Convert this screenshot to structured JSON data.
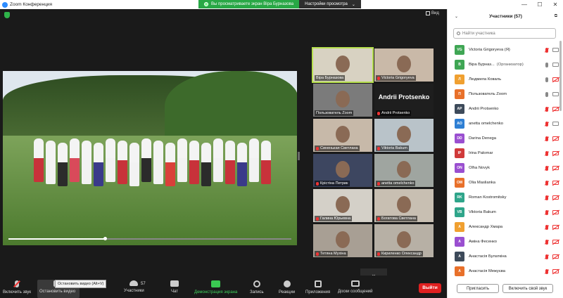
{
  "window": {
    "title": "Zoom Конференция",
    "share_banner": "Вы просматриваете экран Віра Бурназова",
    "view_options": "Настройки просмотра",
    "view_label": "Вид"
  },
  "tiles": [
    {
      "name": "Віра Бурназова",
      "mic": "on",
      "active": true
    },
    {
      "name": "Victoria Grigoryeva",
      "mic": "off"
    },
    {
      "name": "Пользователь Zoom",
      "mic": "on"
    },
    {
      "name": "Andrii Protsenko",
      "mic": "off",
      "big_name": "Andrii Protsenko"
    },
    {
      "name": "Синенькая Светлана",
      "mic": "off"
    },
    {
      "name": "Viktoria Bakum",
      "mic": "off"
    },
    {
      "name": "Крістіна Петрик",
      "mic": "off"
    },
    {
      "name": "anetta omelchenko",
      "mic": "off"
    },
    {
      "name": "Галина Юрьевна",
      "mic": "off"
    },
    {
      "name": "Богатова Светлана",
      "mic": "off"
    },
    {
      "name": "Тетяна Мухіна",
      "mic": "off"
    },
    {
      "name": "Кириленко Олександр",
      "mic": "off"
    }
  ],
  "shared_video": {
    "progress": 0.34
  },
  "toolbar": {
    "unmute": "Включить звук",
    "stop_video": "Остановить видео",
    "tooltip": "Остановить видео (Alt+V)",
    "participants": "Участники",
    "participants_count": "57",
    "chat": "Чат",
    "share": "Демонстрация экрана",
    "record": "Запись",
    "reactions": "Реакции",
    "apps": "Приложения",
    "whiteboards": "Доски сообщений",
    "leave": "Выйти"
  },
  "panel": {
    "title": "Участники (57)",
    "search_placeholder": "Найти участника",
    "invite": "Пригласить",
    "unmute_me": "Включить свой звук",
    "participants": [
      {
        "initials": "VG",
        "name": "Victoria Grigoryeva (Я)",
        "color": "#3fa654",
        "mic": "off",
        "video": "on",
        "tag": ""
      },
      {
        "initials": "В",
        "name": "Віра Бурназ...",
        "color": "#3fa654",
        "mic": "on",
        "video": "on",
        "tag": "(Организатор)"
      },
      {
        "initials": "Л",
        "name": "Людмила Коваль",
        "color": "#f0a030",
        "mic": "on",
        "video": "off",
        "tag": ""
      },
      {
        "initials": "П",
        "name": "Пользователь Zoom",
        "color": "#e8702a",
        "mic": "on",
        "video": "on",
        "tag": ""
      },
      {
        "initials": "AP",
        "name": "Andrii Protsenko",
        "color": "#3d4a5a",
        "mic": "off",
        "video": "off",
        "tag": ""
      },
      {
        "initials": "AO",
        "name": "anetta omelchenko",
        "color": "#2e7fd4",
        "mic": "off",
        "video": "on",
        "tag": ""
      },
      {
        "initials": "DD",
        "name": "Darina Denega",
        "color": "#9a4fd0",
        "mic": "off",
        "video": "off",
        "tag": ""
      },
      {
        "initials": "IP",
        "name": "Irina Palomar",
        "color": "#d03a3a",
        "mic": "off",
        "video": "off",
        "tag": ""
      },
      {
        "initials": "ON",
        "name": "Olha Novyk",
        "color": "#9a4fd0",
        "mic": "off",
        "video": "off",
        "tag": ""
      },
      {
        "initials": "OM",
        "name": "Olia Maslianka",
        "color": "#e8702a",
        "mic": "off",
        "video": "off",
        "tag": ""
      },
      {
        "initials": "RK",
        "name": "Roman Kostromitsky",
        "color": "#2fa58a",
        "mic": "off",
        "video": "off",
        "tag": ""
      },
      {
        "initials": "VB",
        "name": "Viktoria Bakum",
        "color": "#2fa58a",
        "mic": "off",
        "video": "off",
        "tag": ""
      },
      {
        "initials": "А",
        "name": "Александр Хмара",
        "color": "#f0a030",
        "mic": "off",
        "video": "off",
        "tag": ""
      },
      {
        "initials": "А",
        "name": "Аміна Фесенко",
        "color": "#9a4fd0",
        "mic": "off",
        "video": "off",
        "tag": ""
      },
      {
        "initials": "А",
        "name": "Анастасія Булаткіна",
        "color": "#3d4a5a",
        "mic": "off",
        "video": "off",
        "tag": ""
      },
      {
        "initials": "А",
        "name": "Анастасія Межуєва",
        "color": "#e8702a",
        "mic": "off",
        "video": "off",
        "tag": ""
      }
    ]
  }
}
